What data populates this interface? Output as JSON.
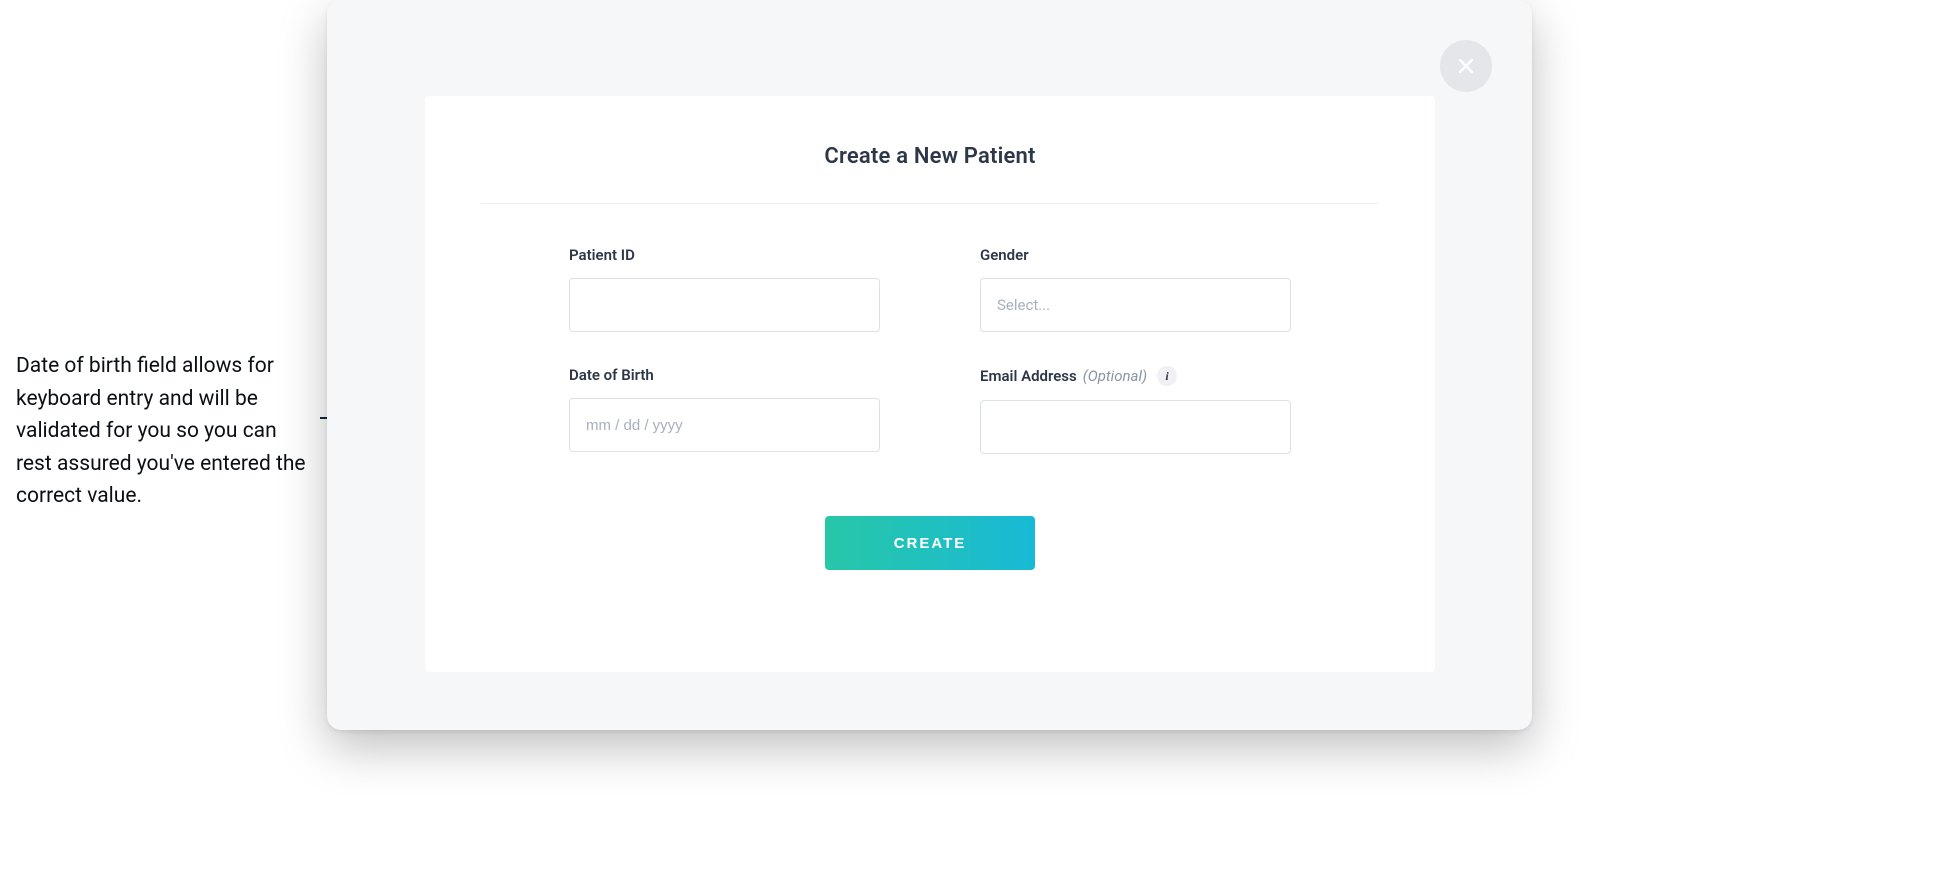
{
  "annotation": {
    "text": "Date of birth field allows for keyboard entry and will be validated for you so you can rest assured you've entered the correct value."
  },
  "modal": {
    "title": "Create a New Patient",
    "close_icon": "close-icon",
    "fields": {
      "patient_id": {
        "label": "Patient ID",
        "value": ""
      },
      "gender": {
        "label": "Gender",
        "placeholder": "Select..."
      },
      "dob": {
        "label": "Date of Birth",
        "placeholder": "mm / dd / yyyy",
        "value": ""
      },
      "email": {
        "label": "Email Address",
        "optional_text": "(Optional)",
        "value": "",
        "info_icon": "i"
      }
    },
    "actions": {
      "create_label": "CREATE"
    }
  }
}
